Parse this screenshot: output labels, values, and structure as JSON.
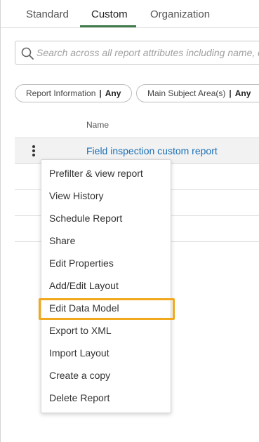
{
  "tabs": [
    {
      "label": "Standard"
    },
    {
      "label": "Custom"
    },
    {
      "label": "Organization"
    }
  ],
  "active_tab": "Custom",
  "search": {
    "placeholder": "Search across all report attributes including name, d"
  },
  "filters": [
    {
      "label": "Report Information",
      "value": "Any"
    },
    {
      "label": "Main Subject Area(s)",
      "value": "Any"
    }
  ],
  "filter_separator": "|",
  "table": {
    "columns": [
      "Name"
    ],
    "rows": [
      {
        "name": "Field inspection custom report"
      }
    ]
  },
  "context_menu": {
    "items": [
      "Prefilter & view report",
      "View History",
      "Schedule Report",
      "Share",
      "Edit Properties",
      "Add/Edit Layout",
      "Edit Data Model",
      "Export to XML",
      "Import Layout",
      "Create a copy",
      "Delete Report"
    ],
    "highlighted_item": "Edit Data Model"
  },
  "colors": {
    "accent_tab": "#3f7a4a",
    "link": "#1a6fb5",
    "highlight_outline": "#f0a81c"
  }
}
